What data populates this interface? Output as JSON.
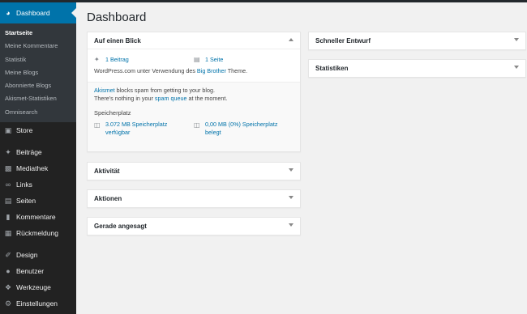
{
  "sidebar": {
    "dashboard_label": "Dashboard",
    "submenu": [
      "Startseite",
      "Meine Kommentare",
      "Statistik",
      "Meine Blogs",
      "Abonnierte Blogs",
      "Akismet-Statistiken",
      "Omnisearch"
    ],
    "store_label": "Store",
    "items": [
      "Beiträge",
      "Mediathek",
      "Links",
      "Seiten",
      "Kommentare",
      "Rückmeldung"
    ],
    "items2": [
      "Design",
      "Benutzer",
      "Werkzeuge",
      "Einstellungen"
    ]
  },
  "page_title": "Dashboard",
  "glance": {
    "title": "Auf einen Blick",
    "posts": "1 Beitrag",
    "pages": "1 Seite",
    "theme_prefix": "WordPress.com unter Verwendung des",
    "theme_name": "Big Brother",
    "theme_suffix": "Theme.",
    "akismet_link": "Akismet",
    "akismet_text": "blocks spam from getting to your blog.",
    "spam_prefix": "There's nothing in your",
    "spam_link": "spam queue",
    "spam_suffix": "at the moment.",
    "storage_title": "Speicherplatz",
    "storage_free_1": "3.072 MB Speicherplatz",
    "storage_free_2": "verfügbar",
    "storage_used_1": "0,00 MB (0%) Speicherplatz",
    "storage_used_2": "belegt"
  },
  "boxes": {
    "aktivitaet": "Aktivität",
    "aktionen": "Aktionen",
    "gerade": "Gerade angesagt",
    "entwurf": "Schneller Entwurf",
    "statistiken": "Statistiken"
  },
  "colors": {
    "accent": "#0073aa",
    "sidebar": "#222222",
    "background": "#f1f1f1"
  }
}
